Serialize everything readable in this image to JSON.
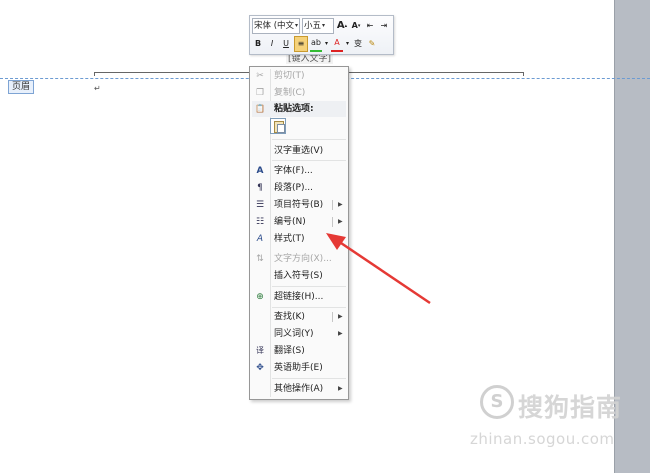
{
  "document": {
    "header_tab": "页眉",
    "placeholder": "[键入文字]",
    "paragraph_mark": "↵"
  },
  "mini_toolbar": {
    "font_name": "宋体 (中文",
    "font_size": "小五",
    "grow_font": "A",
    "shrink_font": "A",
    "decrease_indent": "⇤",
    "increase_indent": "⇥",
    "bold": "B",
    "italic": "I",
    "underline": "U",
    "center": "≡",
    "highlight": "ab",
    "font_color": "A",
    "phonetic": "变",
    "format_painter": "✎",
    "highlight_color": "#33bb33",
    "font_color_value": "#dd2222"
  },
  "context_menu": {
    "items": [
      {
        "icon": "scissors-icon",
        "glyph": "✂",
        "label": "剪切(T)",
        "disabled": true
      },
      {
        "icon": "copy-icon",
        "glyph": "❐",
        "label": "复制(C)",
        "disabled": true
      },
      {
        "icon": "paste-icon",
        "glyph": "📋",
        "label": "粘贴选项:",
        "bold": true
      },
      {
        "label": "汉字重选(V)"
      },
      {
        "icon": "font-icon",
        "glyph": "A",
        "label": "字体(F)..."
      },
      {
        "icon": "paragraph-icon",
        "glyph": "¶",
        "label": "段落(P)..."
      },
      {
        "icon": "bullets-icon",
        "glyph": "☰",
        "label": "项目符号(B)",
        "submenu": true,
        "split": true
      },
      {
        "icon": "numbering-icon",
        "glyph": "☷",
        "label": "编号(N)",
        "submenu": true,
        "split": true
      },
      {
        "icon": "styles-icon",
        "glyph": "A",
        "label": "样式(T)",
        "submenu": true
      },
      {
        "icon": "text-direction-icon",
        "glyph": "⇅",
        "label": "文字方向(X)...",
        "disabled": true
      },
      {
        "label": "插入符号(S)"
      },
      {
        "icon": "hyperlink-icon",
        "glyph": "⊕",
        "label": "超链接(H)..."
      },
      {
        "label": "查找(K)",
        "submenu": true,
        "split": true
      },
      {
        "label": "同义词(Y)",
        "submenu": true
      },
      {
        "icon": "translate-icon",
        "glyph": "译",
        "label": "翻译(S)"
      },
      {
        "icon": "english-assistant-icon",
        "glyph": "✥",
        "label": "英语助手(E)"
      },
      {
        "label": "其他操作(A)",
        "submenu": true
      }
    ]
  },
  "watermark": {
    "logo_glyph": "S",
    "text": "搜狗指南",
    "url": "zhinan.sogou.com"
  },
  "colors": {
    "annotation_arrow": "#e53935"
  }
}
